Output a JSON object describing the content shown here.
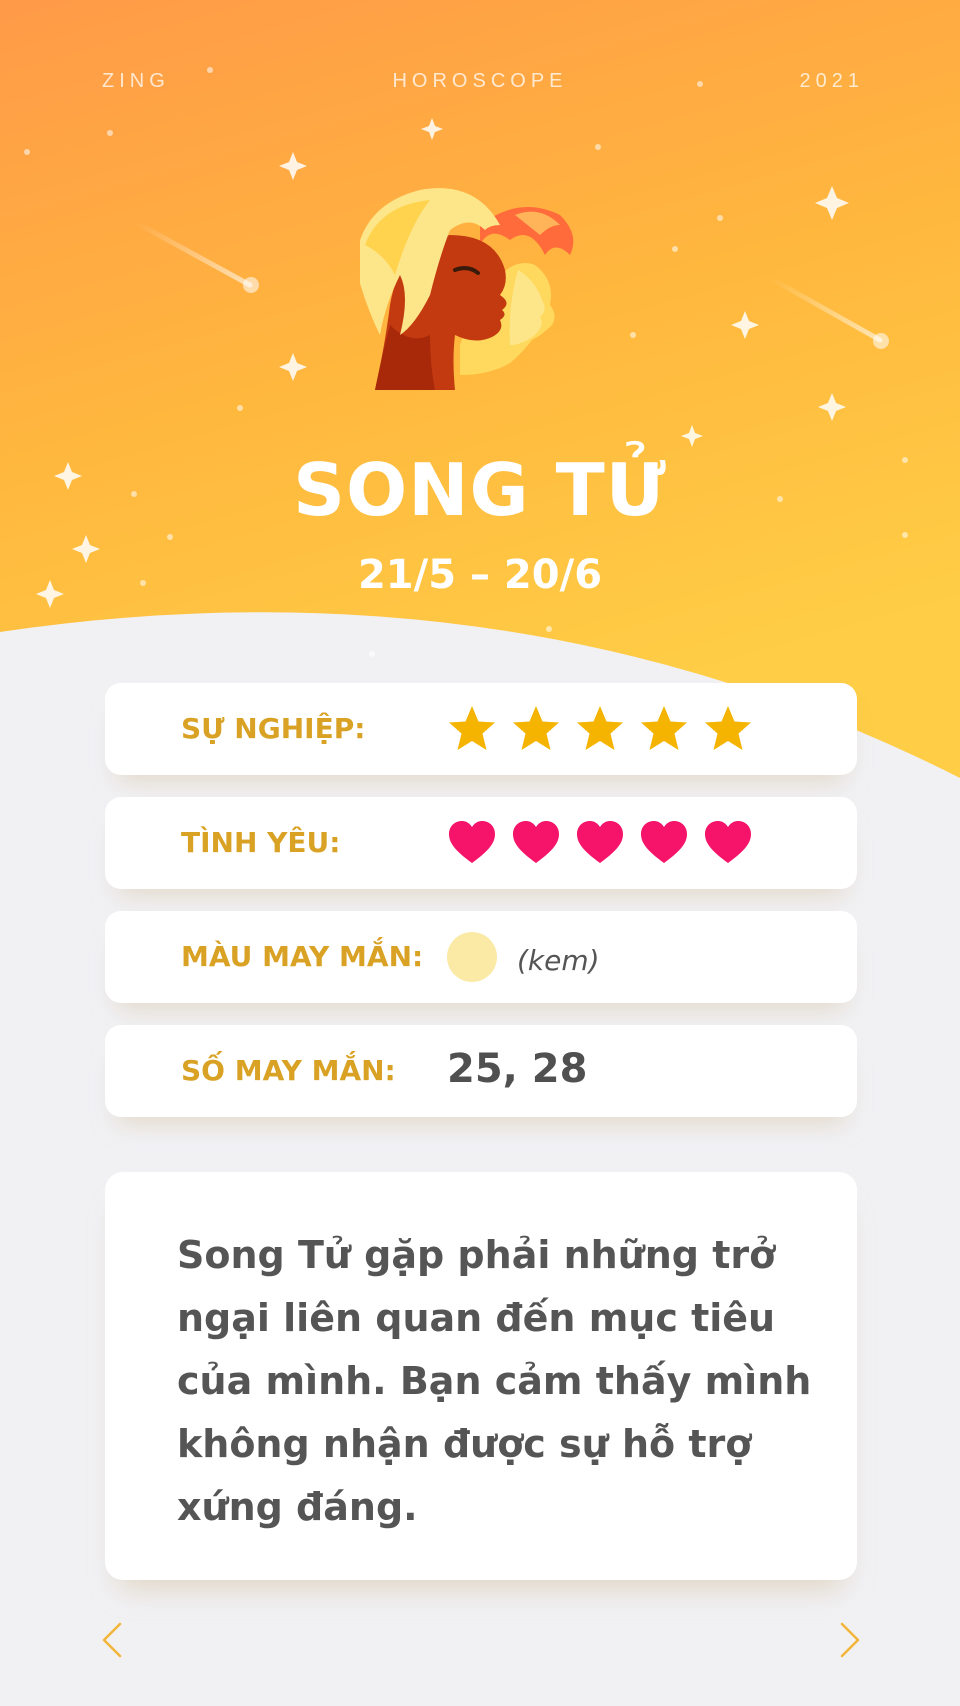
{
  "header": {
    "brand": "ZING",
    "title": "HOROSCOPE",
    "year": "2021"
  },
  "sign": {
    "name": "SONG TỬ",
    "dates": "21/5 – 20/6",
    "icon": "gemini-faces-icon"
  },
  "stats": {
    "career": {
      "label": "SỰ NGHIỆP:",
      "rating": 5,
      "max": 5,
      "icon": "star-icon",
      "color": "#f5b400"
    },
    "love": {
      "label": "TÌNH YÊU:",
      "rating": 5,
      "max": 5,
      "icon": "heart-icon",
      "color": "#f5146a"
    },
    "lucky_color": {
      "label": "MÀU MAY MẮN:",
      "name": "(kem)",
      "swatch": "#fbeaa6"
    },
    "lucky_number": {
      "label": "SỐ MAY MẮN:",
      "value": "25, 28"
    }
  },
  "description": "Song Tử gặp phải những trở ngại liên quan đến mục tiêu của mình. Bạn cảm thấy mình không nhận được sự hỗ trợ xứng đáng.",
  "nav": {
    "prev_icon": "chevron-left-icon",
    "next_icon": "chevron-right-icon",
    "arrow_color": "#f3b53a"
  },
  "colors": {
    "hero_top": "#ff9a45",
    "hero_bottom": "#ffcb45",
    "label": "#d9a224",
    "background": "#f1f1f4"
  }
}
